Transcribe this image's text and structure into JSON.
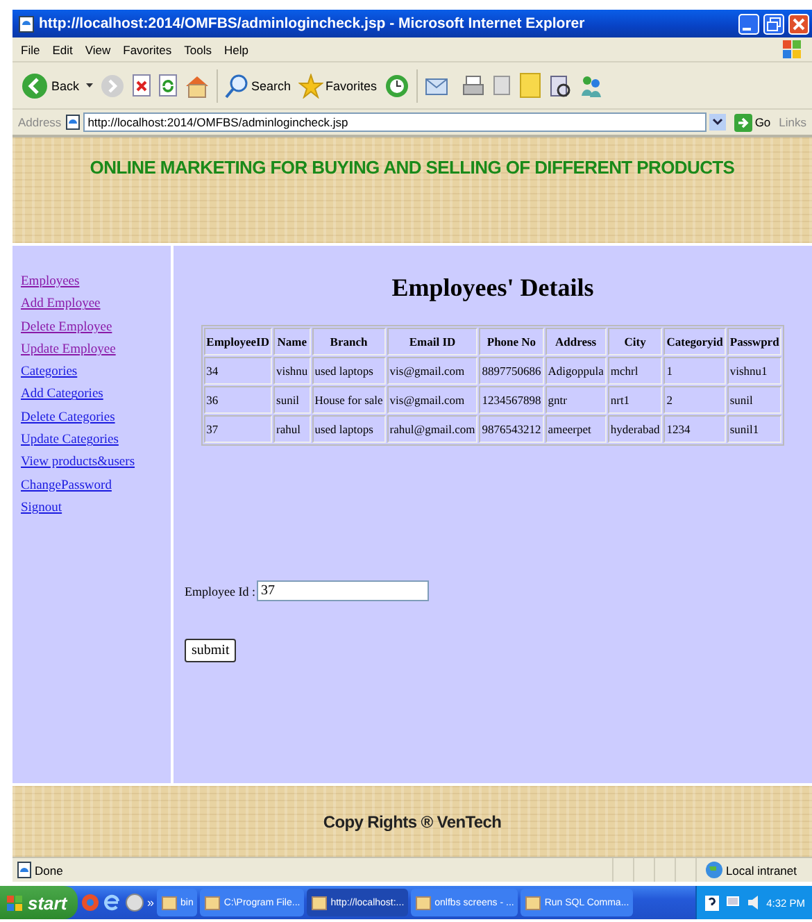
{
  "window": {
    "title": "http://localhost:2014/OMFBS/adminlogincheck.jsp - Microsoft Internet Explorer"
  },
  "menu": [
    "File",
    "Edit",
    "View",
    "Favorites",
    "Tools",
    "Help"
  ],
  "toolbar": {
    "back": "Back",
    "search": "Search",
    "favorites": "Favorites"
  },
  "address_bar": {
    "label": "Address",
    "value": "http://localhost:2014/OMFBS/adminlogincheck.jsp",
    "go": "Go",
    "links": "Links"
  },
  "banner": {
    "title": "ONLINE MARKETING FOR BUYING AND SELLING OF DIFFERENT PRODUCTS"
  },
  "sidebar": {
    "items": [
      {
        "label": "Employees",
        "visited": true
      },
      {
        "label": "Add Employee",
        "visited": true
      },
      {
        "label": "Delete Employee",
        "visited": true
      },
      {
        "label": "Update Employee",
        "visited": true
      },
      {
        "label": "Categories",
        "visited": false
      },
      {
        "label": "Add Categories",
        "visited": false
      },
      {
        "label": "Delete Categories",
        "visited": false
      },
      {
        "label": "Update Categories",
        "visited": false
      },
      {
        "label": "View products&users",
        "visited": false
      },
      {
        "label": "ChangePassword",
        "visited": false
      },
      {
        "label": "Signout",
        "visited": false
      }
    ]
  },
  "heading": "Employees' Details",
  "table": {
    "columns": [
      "EmployeeID",
      "Name",
      "Branch",
      "Email ID",
      "Phone No",
      "Address",
      "City",
      "Categoryid",
      "Passwprd"
    ],
    "rows": [
      [
        "34",
        "vishnu",
        "used laptops",
        "vis@gmail.com",
        "8897750686",
        "Adigoppula",
        "mchrl",
        "1",
        "vishnu1"
      ],
      [
        "36",
        "sunil",
        "House for sale",
        "vis@gmail.com",
        "1234567898",
        "gntr",
        "nrt1",
        "2",
        "sunil"
      ],
      [
        "37",
        "rahul",
        "used laptops",
        "rahul@gmail.com",
        "9876543212",
        "ameerpet",
        "hyderabad",
        "1234",
        "sunil1"
      ]
    ]
  },
  "form": {
    "label": "Employee Id :",
    "value": "37",
    "submit": "submit"
  },
  "footer": {
    "text": "Copy Rights ® VenTech"
  },
  "status_bar": {
    "status": "Done",
    "zone": "Local intranet"
  },
  "taskbar": {
    "start": "start",
    "more": "»",
    "tasks": [
      {
        "label": "bin",
        "selected": false
      },
      {
        "label": "C:\\Program File...",
        "selected": false
      },
      {
        "label": "http://localhost:...",
        "selected": true
      },
      {
        "label": "onlfbs screens - ...",
        "selected": false
      },
      {
        "label": "Run SQL Comma...",
        "selected": false
      }
    ],
    "time": "4:32 PM"
  }
}
